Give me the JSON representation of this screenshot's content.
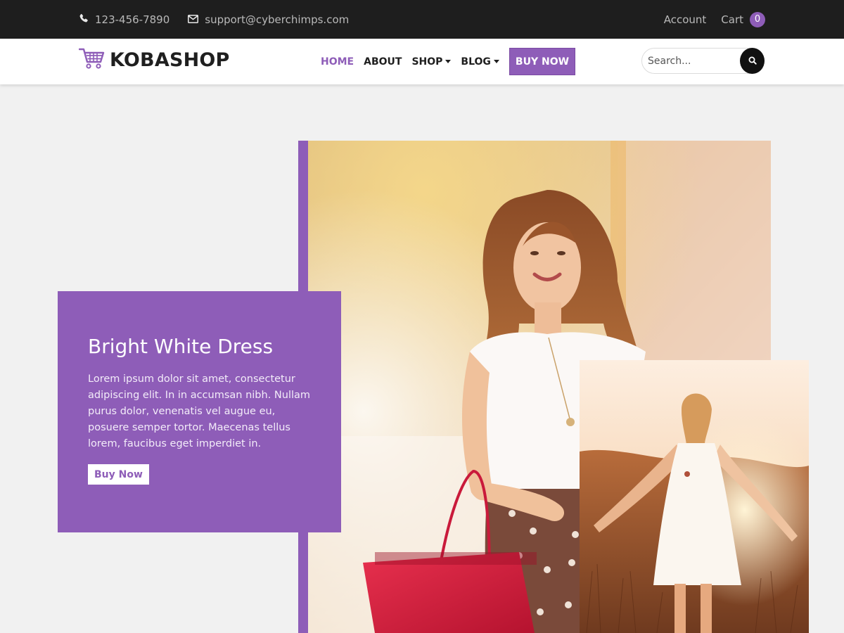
{
  "topbar": {
    "phone": "123-456-7890",
    "email": "support@cyberchimps.com",
    "account_label": "Account",
    "cart_label": "Cart",
    "cart_count": "0",
    "phone_icon": "phone-icon",
    "email_icon": "envelope-icon"
  },
  "header": {
    "logo_text": "KOBASHOP",
    "logo_icon": "cart-icon",
    "nav": {
      "home": "HOME",
      "about": "ABOUT",
      "shop": "SHOP",
      "blog": "BLOG",
      "buy_now": "BUY NOW"
    },
    "search": {
      "placeholder": "Search...",
      "icon": "search-icon"
    }
  },
  "hero": {
    "title": "Bright White Dress",
    "text": "Lorem ipsum dolor sit amet, consectetur adipiscing elit. In in accumsan nibh. Nullam purus dolor, venenatis vel augue eu, posuere semper tortor. Maecenas tellus lorem, faucibus eget imperdiet in.",
    "button_label": "Buy Now"
  },
  "colors": {
    "accent": "#8e5db8",
    "topbar_bg": "#1e1e1e",
    "page_bg": "#f1f1f1"
  }
}
